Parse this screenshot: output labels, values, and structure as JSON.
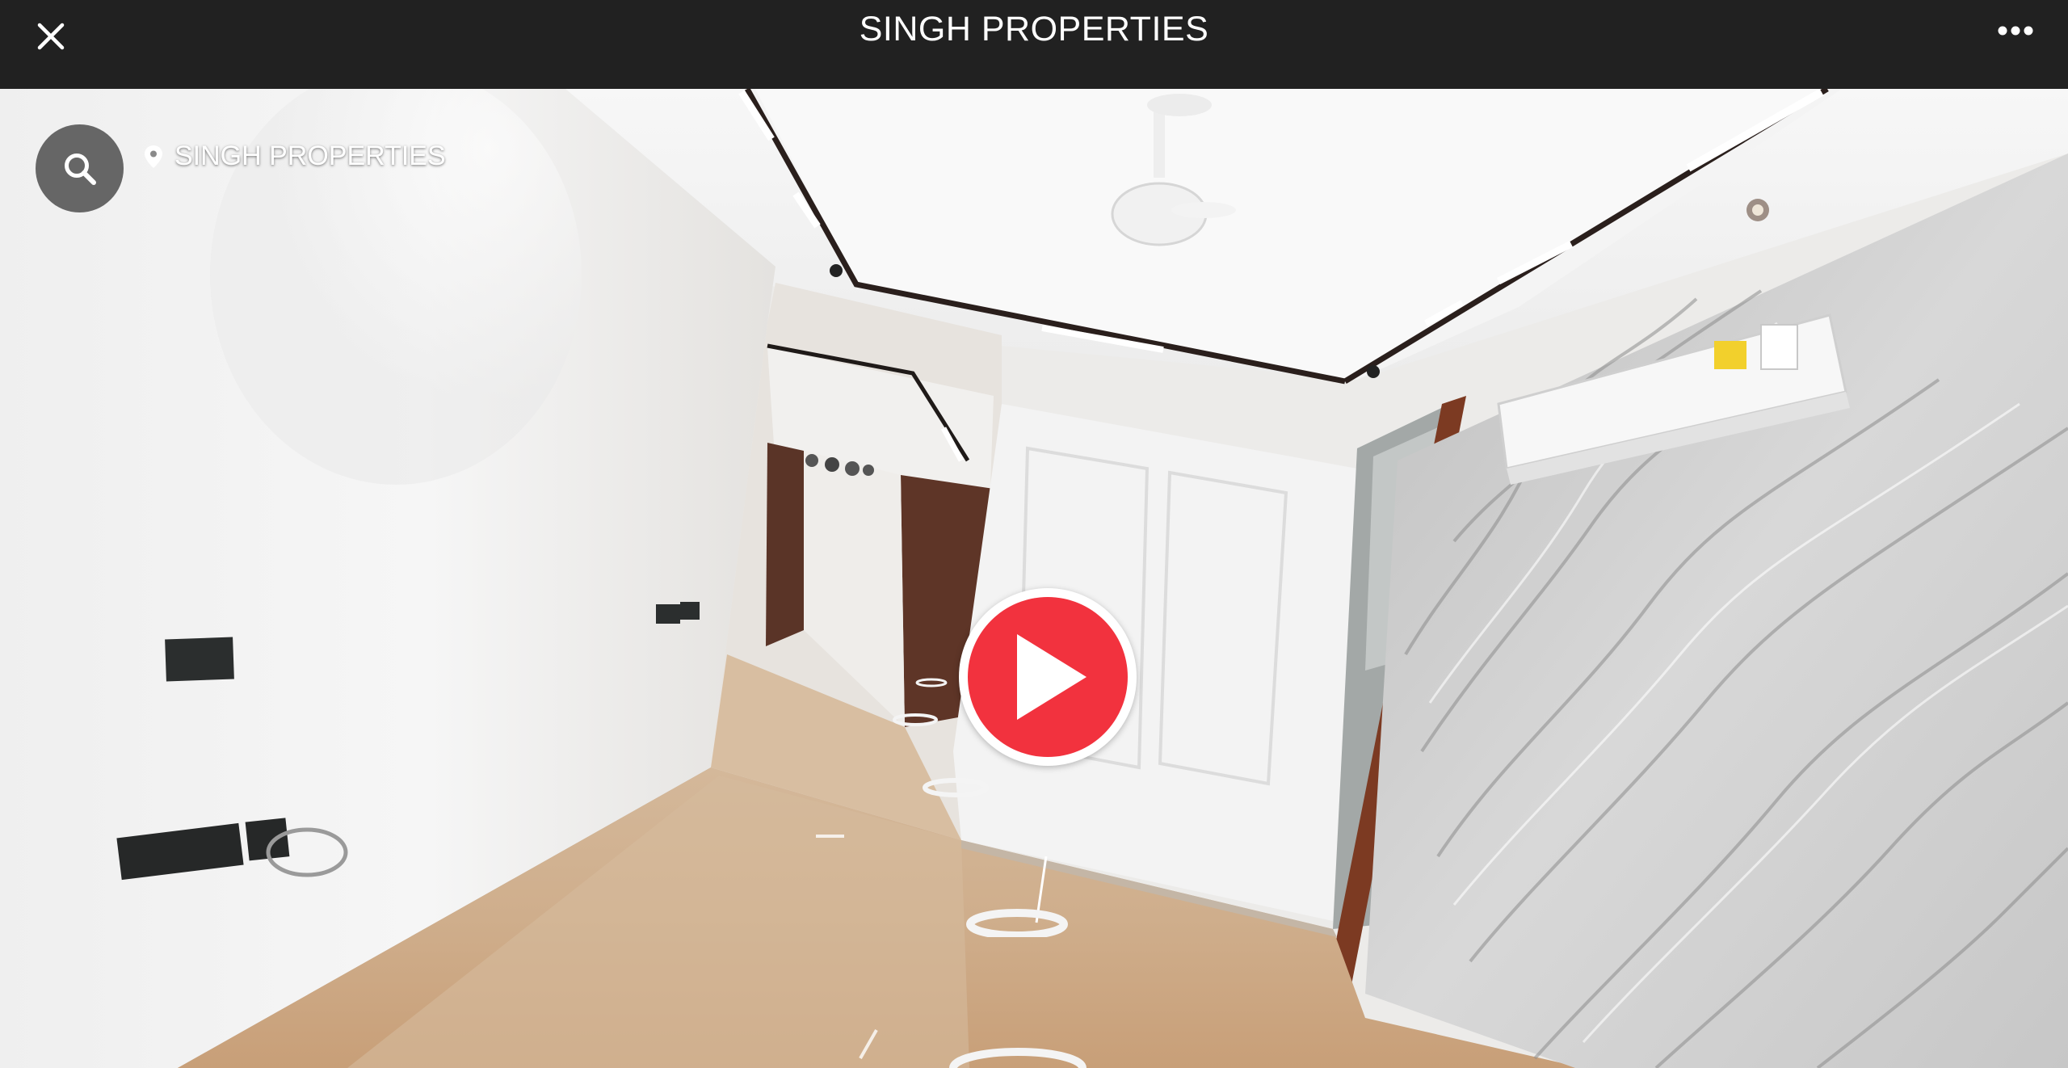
{
  "header": {
    "title": "SINGH PROPERTIES",
    "close_icon": "close-icon",
    "more_icon": "more-horizontal-icon"
  },
  "viewer": {
    "search_icon": "search-icon",
    "location_icon": "map-pin-icon",
    "location_label": "SINGH PROPERTIES",
    "play_icon": "play-icon",
    "colors": {
      "play_accent": "#f2323e",
      "topbar": "#212121"
    }
  }
}
